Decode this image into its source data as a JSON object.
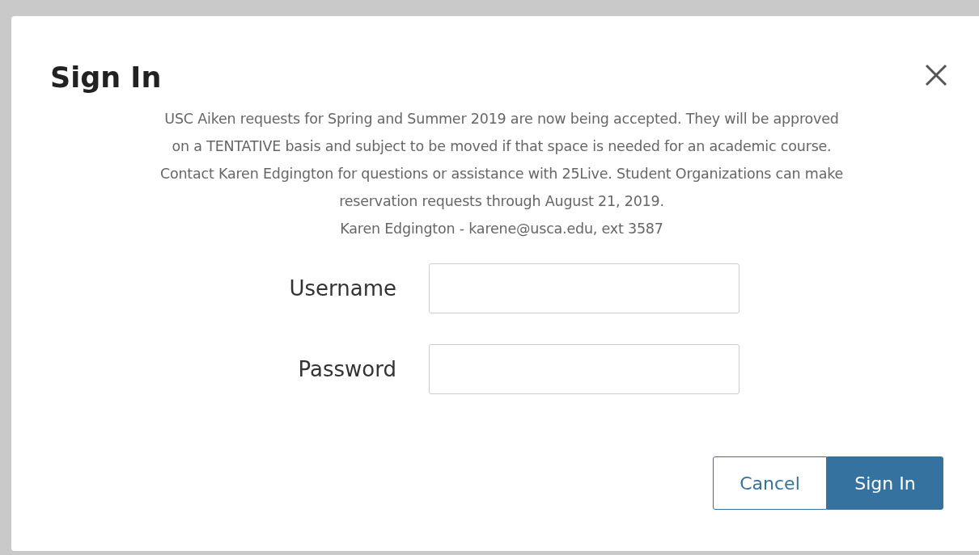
{
  "dialog": {
    "title": "Sign In",
    "message_lines": [
      "USC Aiken requests for Spring and Summer 2019 are now being accepted. They will be approved",
      "on a TENTATIVE basis and subject to be moved if that space is needed for an academic course.",
      "Contact Karen Edgington for questions or assistance with 25Live. Student Organizations can make",
      "reservation requests through August 21, 2019.",
      "Karen Edgington - karene@usca.edu, ext 3587"
    ],
    "fields": [
      {
        "label": "Username"
      },
      {
        "label": "Password"
      }
    ],
    "buttons": [
      {
        "label": "Cancel",
        "kind": "secondary"
      },
      {
        "label": "Sign In",
        "kind": "primary"
      }
    ]
  }
}
